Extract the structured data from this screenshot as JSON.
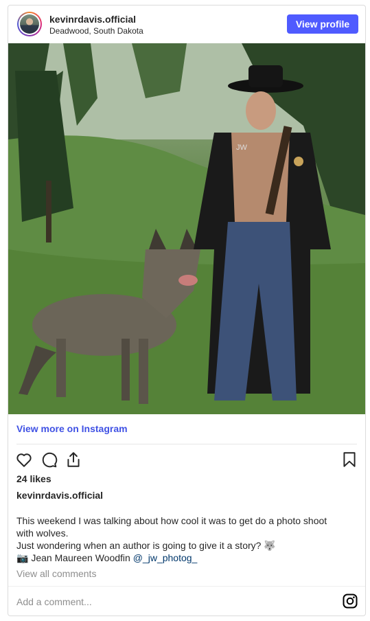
{
  "header": {
    "username": "kevinrdavis.official",
    "location": "Deadwood, South Dakota",
    "view_profile_label": "View profile"
  },
  "photo": {
    "description_icon": "photo",
    "watermark": "JW"
  },
  "footer": {
    "view_more_label": "View more on Instagram",
    "likes_label": "24 likes",
    "caption_username": "kevinrdavis.official",
    "caption_lines": [
      "This weekend I was talking about how cool it was to get do a photo shoot",
      "with wolves.",
      "Just wondering when an author is going to give it a story? 🐺"
    ],
    "credit_prefix": "📷 Jean Maureen Woodfin ",
    "credit_mention": "@_jw_photog_",
    "view_all_comments_label": "View all comments",
    "add_comment_placeholder": "Add a comment..."
  },
  "icons": {
    "like": "heart-icon",
    "comment": "comment-icon",
    "share": "share-icon",
    "save": "bookmark-icon",
    "brand": "instagram-icon"
  },
  "colors": {
    "accent": "#4f5bff",
    "link": "#3f51e4",
    "mention": "#00376b",
    "muted": "#8e8e8e"
  }
}
